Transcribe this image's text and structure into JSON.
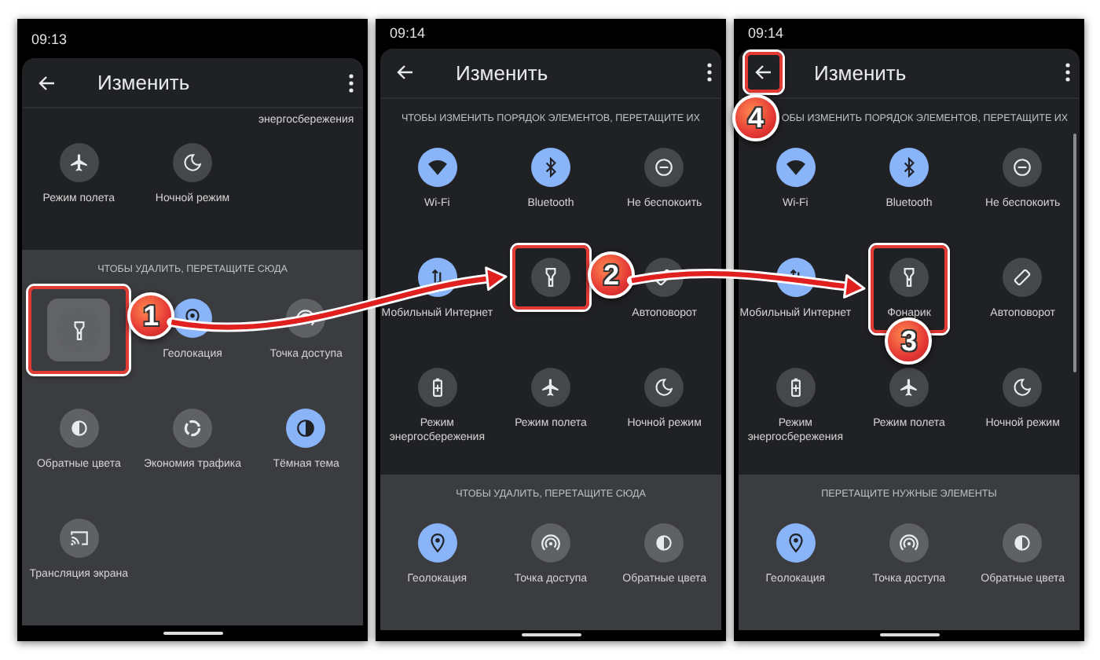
{
  "phones": [
    {
      "time": "09:13",
      "title": "Изменить",
      "back": {
        "highlighted": false
      },
      "scrollbar": false,
      "sections": [
        {
          "kind": "active",
          "cut_label": "энергосбережения",
          "tiles": [
            {
              "kind": "airplane",
              "label": "Режим полета",
              "on": false,
              "highlighted": false,
              "dragging": false
            },
            {
              "kind": "moon",
              "label": "Ночной режим",
              "on": false,
              "highlighted": false,
              "dragging": false
            }
          ]
        },
        {
          "kind": "spare",
          "heading": "ЧТОБЫ УДАЛИТЬ, ПЕРЕТАЩИТЕ СЮДА",
          "tiles": [
            {
              "kind": "flashlight",
              "on": false,
              "highlighted": true,
              "dragging": true,
              "callout": "1"
            },
            {
              "kind": "location",
              "label": "Геолокация",
              "on": true,
              "highlighted": false,
              "dragging": false
            },
            {
              "kind": "hotspot",
              "label": "Точка доступа",
              "on": false,
              "highlighted": false,
              "dragging": false
            },
            {
              "kind": "invert",
              "label": "Обратные цвета",
              "on": false,
              "highlighted": false,
              "dragging": false
            },
            {
              "kind": "datasaver",
              "label": "Экономия трафика",
              "on": false,
              "highlighted": false,
              "dragging": false
            },
            {
              "kind": "darktheme",
              "label": "Тёмная тема",
              "on": true,
              "highlighted": false,
              "dragging": false
            },
            {
              "kind": "cast",
              "label": "Трансляция экрана",
              "on": false,
              "highlighted": false,
              "dragging": false
            }
          ]
        }
      ]
    },
    {
      "time": "09:14",
      "title": "Изменить",
      "back": {
        "highlighted": false
      },
      "scrollbar": false,
      "sections": [
        {
          "kind": "active",
          "heading": "ЧТОБЫ ИЗМЕНИТЬ ПОРЯДОК ЭЛЕМЕНТОВ, ПЕРЕТАЩИТЕ ИХ",
          "tiles": [
            {
              "kind": "wifi",
              "label": "Wi-Fi",
              "on": true,
              "highlighted": false,
              "dragging": false
            },
            {
              "kind": "bluetooth",
              "label": "Bluetooth",
              "on": true,
              "highlighted": false,
              "dragging": false
            },
            {
              "kind": "dnd",
              "label": "Не беспокоить",
              "on": false,
              "highlighted": false,
              "dragging": false
            },
            {
              "kind": "mobile",
              "label": "Мобильный Интернет",
              "on": true,
              "highlighted": false,
              "dragging": false
            },
            {
              "kind": "flashlight",
              "on": false,
              "highlighted": true,
              "dragging": false,
              "callout": "2"
            },
            {
              "kind": "rotate",
              "label": "Автоповорот",
              "on": false,
              "highlighted": false,
              "dragging": false
            },
            {
              "kind": "battery",
              "label": "Режим энергосбережения",
              "on": false,
              "highlighted": false,
              "dragging": false
            },
            {
              "kind": "airplane",
              "label": "Режим полета",
              "on": false,
              "highlighted": false,
              "dragging": false
            },
            {
              "kind": "moon",
              "label": "Ночной режим",
              "on": false,
              "highlighted": false,
              "dragging": false
            }
          ]
        },
        {
          "kind": "spare",
          "heading": "ЧТОБЫ УДАЛИТЬ, ПЕРЕТАЩИТЕ СЮДА",
          "tiles": [
            {
              "kind": "location",
              "label": "Геолокация",
              "on": true,
              "highlighted": false,
              "dragging": false
            },
            {
              "kind": "hotspot",
              "label": "Точка доступа",
              "on": false,
              "highlighted": false,
              "dragging": false
            },
            {
              "kind": "invert",
              "label": "Обратные цвета",
              "on": false,
              "highlighted": false,
              "dragging": false
            }
          ]
        }
      ]
    },
    {
      "time": "09:14",
      "title": "Изменить",
      "back": {
        "highlighted": true,
        "callout": "4"
      },
      "scrollbar": true,
      "sections": [
        {
          "kind": "active",
          "heading": "ОБЫ ИЗМЕНИТЬ ПОРЯДОК ЭЛЕМЕНТОВ, ПЕРЕТАЩИТЕ ИХ",
          "tiles": [
            {
              "kind": "wifi",
              "label": "Wi-Fi",
              "on": true,
              "highlighted": false,
              "dragging": false
            },
            {
              "kind": "bluetooth",
              "label": "Bluetooth",
              "on": true,
              "highlighted": false,
              "dragging": false
            },
            {
              "kind": "dnd",
              "label": "Не беспокоить",
              "on": false,
              "highlighted": false,
              "dragging": false
            },
            {
              "kind": "mobile",
              "label": "Мобильный Интернет",
              "on": true,
              "highlighted": false,
              "dragging": false
            },
            {
              "kind": "flashlight",
              "label": "Фонарик",
              "on": false,
              "highlighted": true,
              "dragging": false,
              "callout": "3"
            },
            {
              "kind": "rotate",
              "label": "Автоповорот",
              "on": false,
              "highlighted": false,
              "dragging": false
            },
            {
              "kind": "battery",
              "label": "Режим энергосбережения",
              "on": false,
              "highlighted": false,
              "dragging": false
            },
            {
              "kind": "airplane",
              "label": "Режим полета",
              "on": false,
              "highlighted": false,
              "dragging": false
            },
            {
              "kind": "moon",
              "label": "Ночной режим",
              "on": false,
              "highlighted": false,
              "dragging": false
            }
          ]
        },
        {
          "kind": "spare",
          "heading": "ПЕРЕТАЩИТЕ НУЖНЫЕ ЭЛЕМЕНТЫ",
          "tiles": [
            {
              "kind": "location",
              "label": "Геолокация",
              "on": true,
              "highlighted": false,
              "dragging": false
            },
            {
              "kind": "hotspot",
              "label": "Точка доступа",
              "on": false,
              "highlighted": false,
              "dragging": false
            },
            {
              "kind": "invert",
              "label": "Обратные цвета",
              "on": false,
              "highlighted": false,
              "dragging": false
            }
          ]
        }
      ]
    }
  ]
}
